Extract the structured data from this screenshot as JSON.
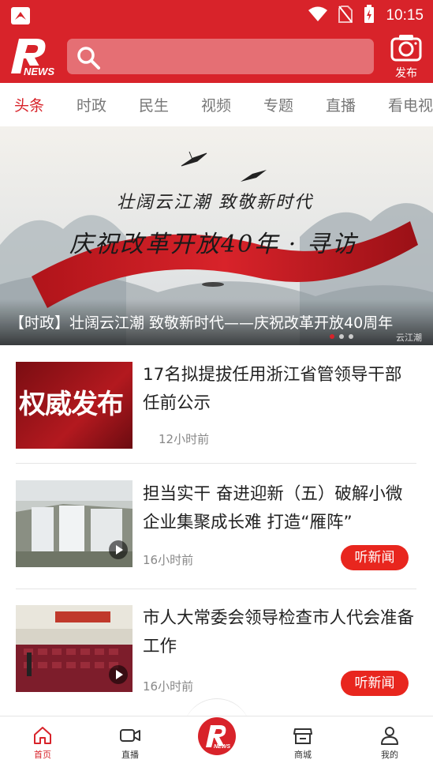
{
  "status_bar": {
    "time": "10:15"
  },
  "header": {
    "logo_text": "NEWS",
    "publish_label": "发布",
    "search_placeholder": ""
  },
  "tabs": [
    {
      "label": "头条",
      "active": true
    },
    {
      "label": "时政",
      "active": false
    },
    {
      "label": "民生",
      "active": false
    },
    {
      "label": "视频",
      "active": false
    },
    {
      "label": "专题",
      "active": false
    },
    {
      "label": "直播",
      "active": false
    },
    {
      "label": "看电视",
      "active": false
    }
  ],
  "banner": {
    "caption": "【时政】壮阔云江潮 致敬新时代——庆祝改革开放40周年",
    "art_line1": "壮阔云江潮 致敬新时代",
    "art_line2": "庆祝改革开放40年 · 寻访",
    "watermark": "云江潮"
  },
  "feed": [
    {
      "title": "17名拟提拔任用浙江省管领导干部任前公示",
      "time": "12小时前",
      "thumb_text": "权威发布",
      "has_listen": false,
      "is_video": false
    },
    {
      "title": "担当实干 奋进迎新（五）破解小微企业集聚成长难 打造“雁阵”",
      "time": "16小时前",
      "has_listen": true,
      "is_video": true
    },
    {
      "title": "市人大常委会领导检查市人代会准备工作",
      "time": "16小时前",
      "has_listen": true,
      "is_video": true
    }
  ],
  "listen_label": "听新闻",
  "bottom_nav": [
    {
      "label": "首页",
      "icon": "home-icon",
      "active": true
    },
    {
      "label": "直播",
      "icon": "video-camera-icon",
      "active": false
    },
    {
      "label": "",
      "icon": "r-news-logo",
      "active": false
    },
    {
      "label": "商城",
      "icon": "store-icon",
      "active": false
    },
    {
      "label": "我的",
      "icon": "profile-icon",
      "active": false
    }
  ],
  "colors": {
    "brand_red": "#d8232a",
    "listen_button": "#e8261e"
  }
}
